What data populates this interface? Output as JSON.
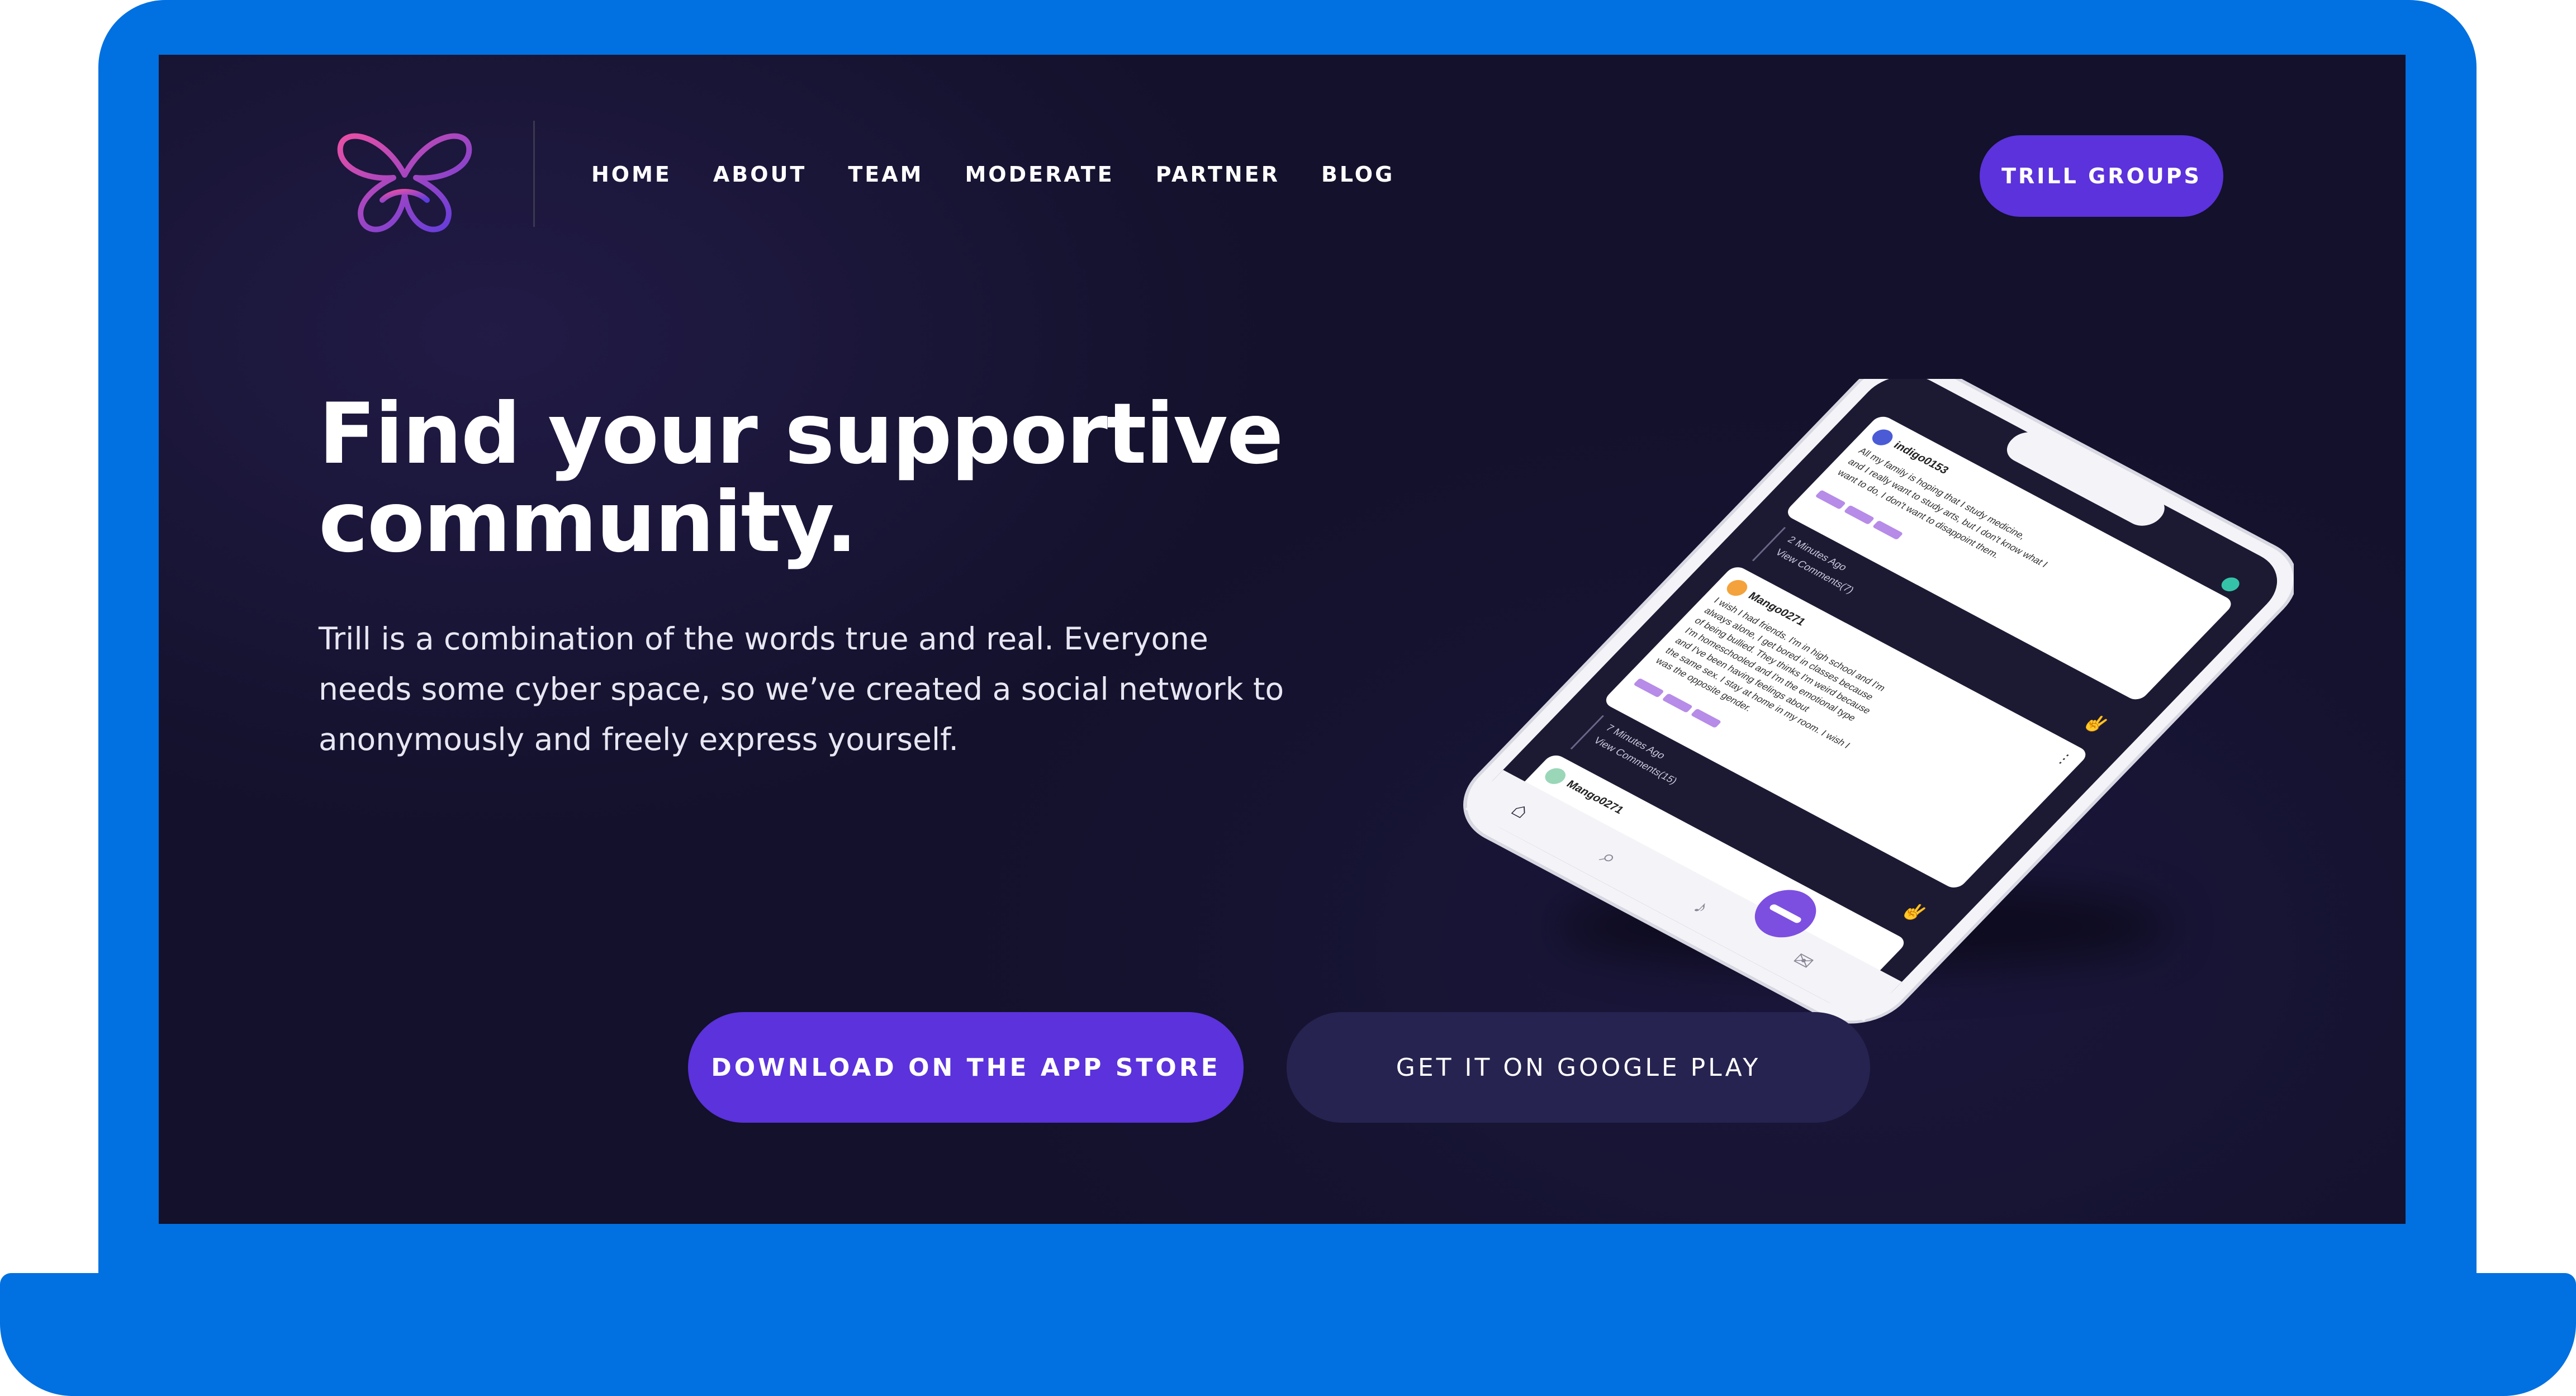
{
  "brand": {
    "accent": "#5b32db",
    "frame_color": "#0170e0",
    "background": "#13112b"
  },
  "logo": {
    "name": "trill-butterfly-logo"
  },
  "nav": {
    "items": [
      {
        "label": "HOME"
      },
      {
        "label": "ABOUT"
      },
      {
        "label": "TEAM"
      },
      {
        "label": "MODERATE"
      },
      {
        "label": "PARTNER"
      },
      {
        "label": "BLOG"
      }
    ],
    "cta_label": "TRILL GROUPS"
  },
  "hero": {
    "title_line1": "Find your supportive",
    "title_line2": "community.",
    "description": "Trill is a combination of the words true and real. Everyone needs some cyber space, so we’ve created a social network to anonymously and freely express yourself."
  },
  "buttons": {
    "app_store": "DOWNLOAD ON THE APP STORE",
    "google_play": "GET IT ON GOOGLE PLAY"
  },
  "phone_feed": {
    "posts": [
      {
        "user": "indigo0153",
        "text": [
          "All my family is hoping that I study medicine,",
          "and I really want to study arts, but I don't know what I",
          "want to do, I don't want to disappoint them."
        ],
        "time": "2 Minutes Ago",
        "comments": "View Comments(7)"
      },
      {
        "user": "Mango0271",
        "text": [
          "I wish I had friends. I'm in high school and I'm",
          "always alone, I get bored in classes because",
          "of being bullied. They thinks I'm weird because",
          "I'm homeschooled and I'm the emotional type",
          "and I've been having feelings about",
          "the same sex. I stay at home in my room. I wish I",
          "was the opposite gender."
        ],
        "time": "7 Minutes Ago",
        "comments": "View Comments(15)"
      },
      {
        "user": "Mango0271",
        "text": [],
        "time": "",
        "comments": ""
      }
    ]
  }
}
